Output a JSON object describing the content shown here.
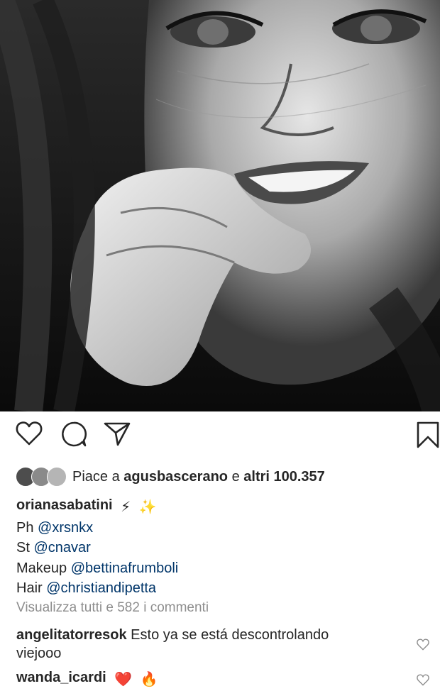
{
  "photo": {
    "description_icon": "portrait-photo",
    "palette": [
      "#0d0d0d",
      "#6e6e6e",
      "#d9d9d9"
    ]
  },
  "actions": {
    "like_icon": "heart-outline-icon",
    "comment_icon": "comment-bubble-icon",
    "share_icon": "paper-plane-icon",
    "save_icon": "bookmark-icon"
  },
  "likes": {
    "prefix": "Piace a",
    "user": "agusbascerano",
    "middle": "e",
    "count": "altri 100.357"
  },
  "caption": {
    "username": "orianasabatini",
    "emojis": [
      "⚡",
      "✨"
    ],
    "lines": [
      {
        "label": "Ph",
        "mention": "@xrsnkx"
      },
      {
        "label": "St",
        "mention": "@cnavar"
      },
      {
        "label": "Makeup",
        "mention": "@bettinafrumboli"
      },
      {
        "label": "Hair",
        "mention": "@christiandipetta"
      }
    ]
  },
  "view_all_comments": "Visualizza tutti e 582 i commenti",
  "comments": [
    {
      "user": "angelitatorresok",
      "text_line1": "Esto ya se está descontrolando",
      "text_line2": "viejooo"
    },
    {
      "user": "wanda_icardi",
      "emojis": [
        "❤️",
        "🔥"
      ]
    }
  ],
  "colors": {
    "mention": "#003569",
    "muted": "#8e8e8e",
    "text": "#262626"
  }
}
